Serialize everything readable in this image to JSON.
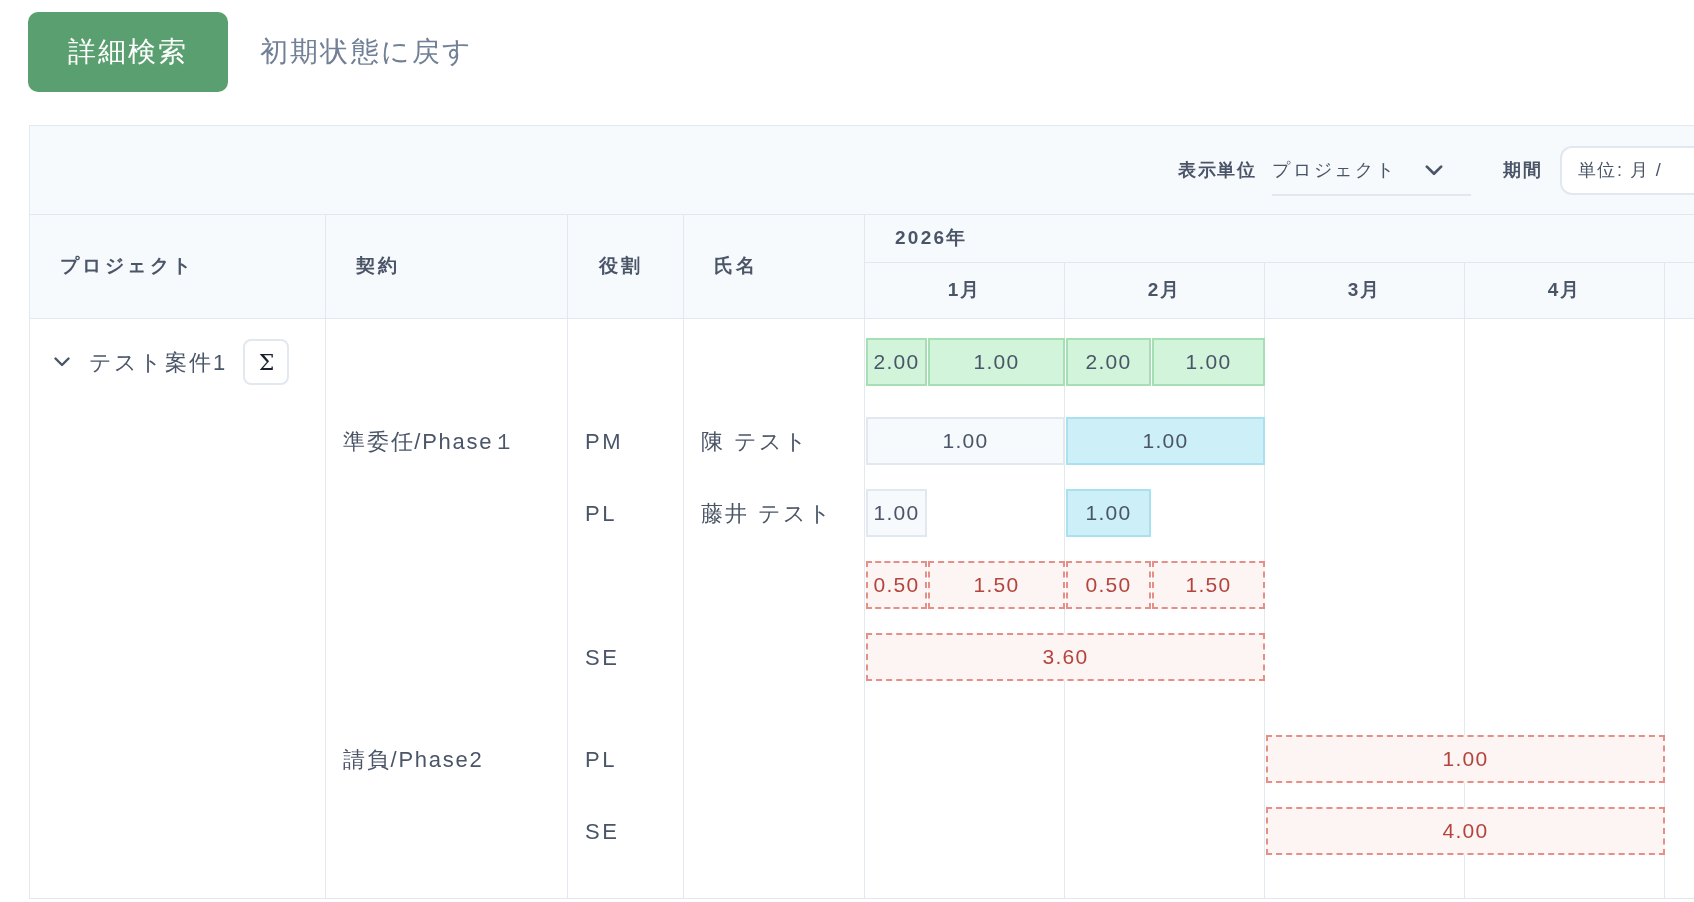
{
  "actions": {
    "search_button": "詳細検索",
    "reset_link": "初期状態に戻す"
  },
  "table": {
    "toolbar": {
      "display_unit": {
        "label": "表示単位",
        "value": "プロジェクト"
      },
      "period": {
        "label": "期間",
        "value": "単位: 月 /"
      }
    },
    "columns": [
      "プロジェクト",
      "契約",
      "役割",
      "氏名"
    ],
    "year": "2026年",
    "months": [
      "1月",
      "2月",
      "3月",
      "4月"
    ],
    "project": {
      "name": "テスト案件1",
      "expanded": true,
      "sum_button": "Σ",
      "bars": [
        {
          "kind": "total",
          "value": "2.00"
        },
        {
          "kind": "total",
          "value": "1.00"
        },
        {
          "kind": "total",
          "value": "2.00"
        },
        {
          "kind": "total",
          "value": "1.00"
        }
      ]
    },
    "contracts": [
      {
        "name": "準委任/Phase１",
        "rows": [
          {
            "role": "PM",
            "person": "陳 テスト",
            "bars": [
              {
                "kind": "planned",
                "value": "1.00"
              },
              {
                "kind": "booked",
                "value": "1.00"
              }
            ]
          },
          {
            "role": "PL",
            "person": "藤井 テスト",
            "bars": [
              {
                "kind": "planned",
                "value": "1.00"
              },
              {
                "kind": "booked",
                "value": "1.00"
              }
            ]
          },
          {
            "bars": [
              {
                "kind": "required",
                "value": "0.50"
              },
              {
                "kind": "required",
                "value": "1.50"
              },
              {
                "kind": "required",
                "value": "0.50"
              },
              {
                "kind": "required",
                "value": "1.50"
              }
            ]
          },
          {
            "role": "SE",
            "bars": [
              {
                "kind": "required",
                "value": "3.60"
              }
            ]
          }
        ]
      },
      {
        "name": "請負/Phase2",
        "rows": [
          {
            "role": "PL",
            "bars": [
              {
                "kind": "required",
                "value": "1.00"
              }
            ]
          },
          {
            "role": "SE",
            "bars": [
              {
                "kind": "required",
                "value": "4.00"
              }
            ]
          }
        ]
      }
    ]
  }
}
